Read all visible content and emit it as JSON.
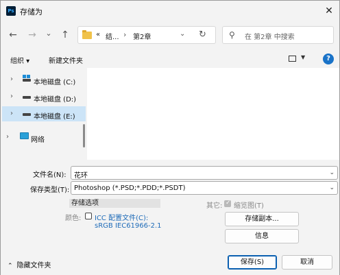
{
  "window": {
    "app_icon_text": "Ps",
    "title": "存储为",
    "close_glyph": "✕"
  },
  "nav": {
    "back_glyph": "←",
    "forward_glyph": "→",
    "recent_glyph": "⌄",
    "up_glyph": "↑",
    "breadcrumb": {
      "overflow": "«",
      "parent": "结...",
      "separator": "›",
      "current": "第2章",
      "dropdown_glyph": "⌄",
      "refresh_glyph": "↻"
    },
    "search": {
      "icon_glyph": "⚲",
      "placeholder": "在 第2章 中搜索"
    }
  },
  "toolbar": {
    "organize_label": "组织 ▾",
    "new_folder_label": "新建文件夹",
    "view_dropdown_glyph": "▼",
    "help_glyph": "?"
  },
  "sidebar": {
    "items": [
      {
        "chev": "›",
        "label": "本地磁盘 (C:)",
        "icon": "windows-drive-icon",
        "selected": false
      },
      {
        "chev": "›",
        "label": "本地磁盘 (D:)",
        "icon": "drive-icon",
        "selected": false
      },
      {
        "chev": "›",
        "label": "本地磁盘 (E:)",
        "icon": "drive-icon",
        "selected": true
      },
      {
        "chev": "›",
        "label": "网络",
        "icon": "network-icon",
        "selected": false
      }
    ]
  },
  "form": {
    "filename_label": "文件名(N):",
    "filename_value": "花环",
    "filetype_label": "保存类型(T):",
    "filetype_value": "Photoshop (*.PSD;*.PDD;*.PSDT)",
    "dropdown_glyph": "⌄",
    "save_options_title": "存储选项",
    "color_label": "颜色:",
    "icc_label": "ICC 配置文件(C):",
    "icc_profile": "sRGB IEC61966-2.1",
    "other_label": "其它:",
    "thumbnail_label": "缩览图(T)",
    "save_copy_button": "存储副本...",
    "info_button": "信息",
    "hide_folders_glyph": "⌃",
    "hide_folders_label": "隐藏文件夹",
    "save_button": "保存(S)",
    "cancel_button": "取消"
  }
}
